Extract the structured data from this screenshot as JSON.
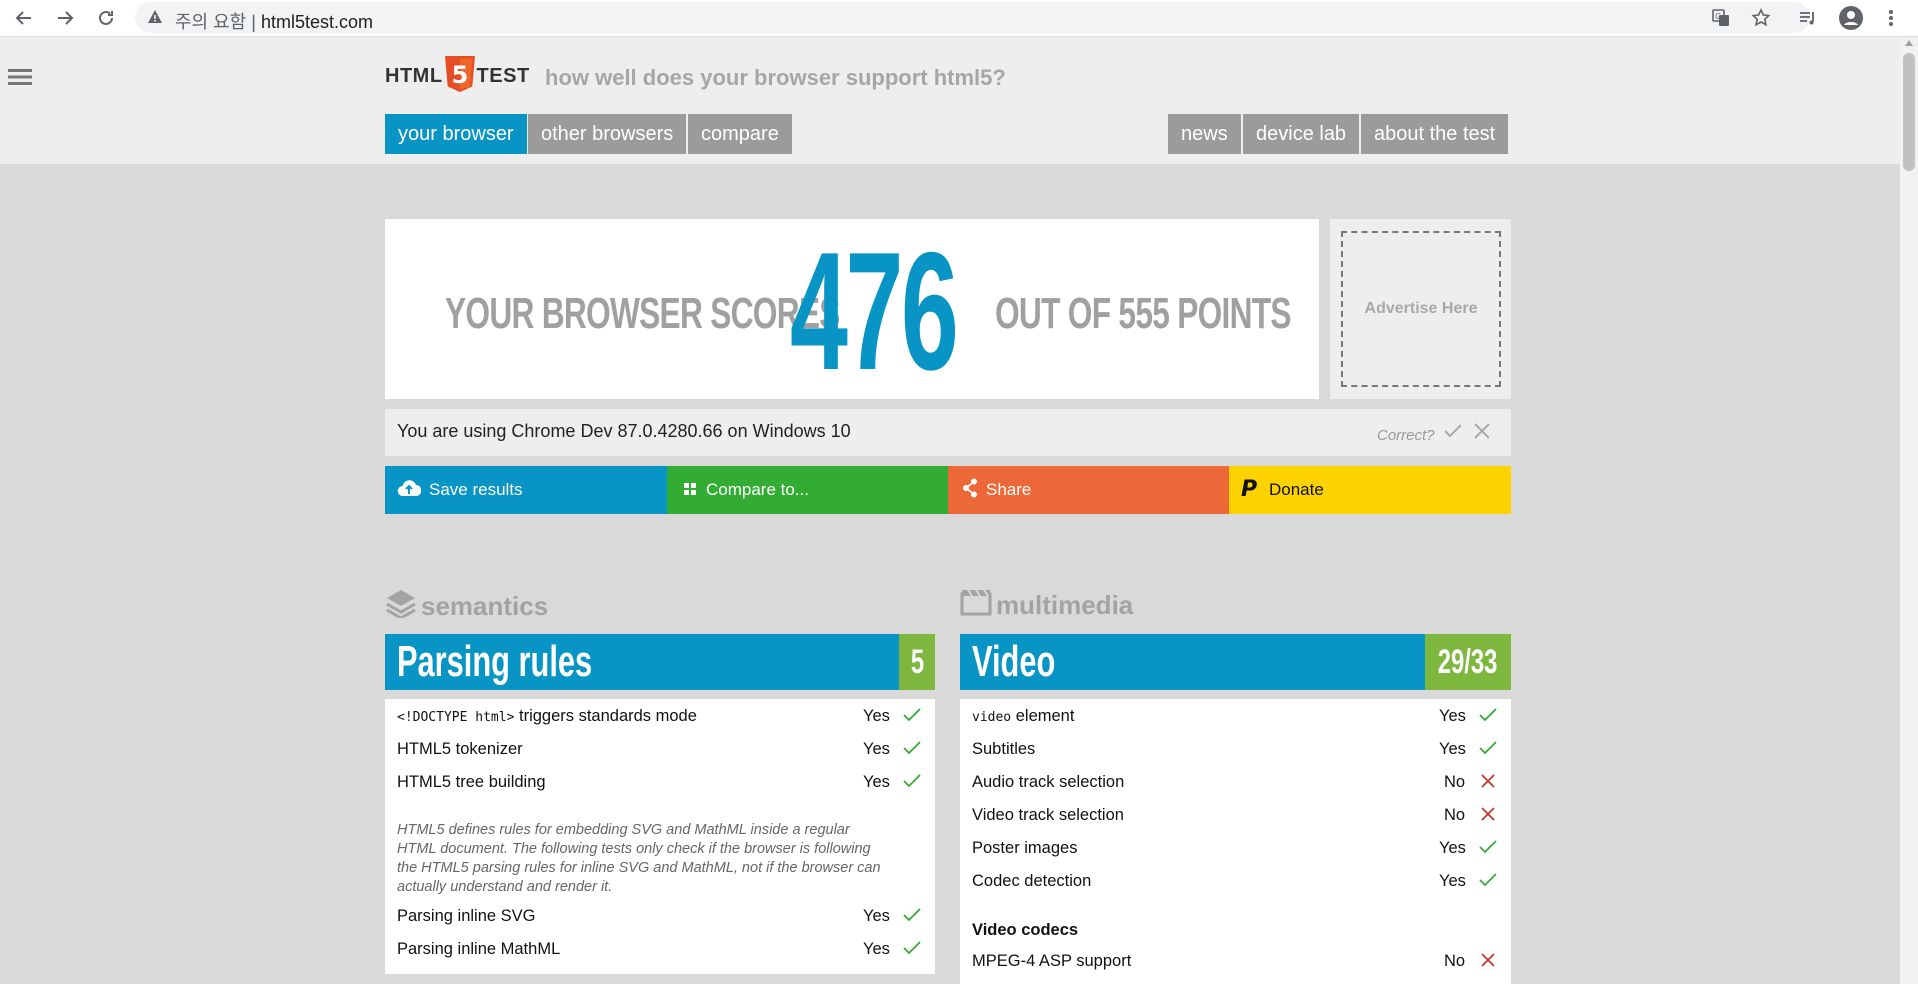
{
  "browser": {
    "security_label": "주의 요함",
    "separator": "|",
    "url": "html5test.com"
  },
  "header": {
    "logo_left": "HTML",
    "logo_digit": "5",
    "logo_right": "TEST",
    "tagline": "how well does your browser support html5?",
    "nav_left": [
      {
        "label": "your browser"
      },
      {
        "label": "other browsers"
      },
      {
        "label": "compare"
      }
    ],
    "nav_right": [
      {
        "label": "news"
      },
      {
        "label": "device lab"
      },
      {
        "label": "about the test"
      }
    ]
  },
  "score": {
    "prefix": "YOUR BROWSER SCORES",
    "value": "476",
    "suffix": "OUT OF 555 POINTS",
    "ad_label": "Advertise Here"
  },
  "ua": {
    "text": "You are using Chrome Dev 87.0.4280.66 on Windows 10",
    "correct_label": "Correct?"
  },
  "actions": {
    "save": "Save results",
    "compare": "Compare to...",
    "share": "Share",
    "donate": "Donate"
  },
  "colors": {
    "blue": "#0894c4",
    "green": "#33ac33",
    "orange": "#ec6838",
    "yellow": "#fcd200",
    "score_green": "#7db73e",
    "yes_check": "#33ac33",
    "no_cross": "#c0392b"
  },
  "semantics": {
    "section_label": "semantics",
    "category": "Parsing rules",
    "score": "5",
    "rows": [
      {
        "code": "<!DOCTYPE html>",
        "name": " triggers standards mode",
        "result": "Yes"
      },
      {
        "name": "HTML5 tokenizer",
        "result": "Yes"
      },
      {
        "name": "HTML5 tree building",
        "result": "Yes"
      }
    ],
    "note": "HTML5 defines rules for embedding SVG and MathML inside a regular HTML document. The following tests only check if the browser is following the HTML5 parsing rules for inline SVG and MathML, not if the browser can actually understand and render it.",
    "rows2": [
      {
        "name": "Parsing inline SVG",
        "result": "Yes"
      },
      {
        "name": "Parsing inline MathML",
        "result": "Yes"
      }
    ]
  },
  "multimedia": {
    "section_label": "multimedia",
    "category": "Video",
    "score": "29/33",
    "rows": [
      {
        "code": "video",
        "name": " element",
        "result": "Yes"
      },
      {
        "name": "Subtitles",
        "result": "Yes"
      },
      {
        "name": "Audio track selection",
        "result": "No"
      },
      {
        "name": "Video track selection",
        "result": "No"
      },
      {
        "name": "Poster images",
        "result": "Yes"
      },
      {
        "name": "Codec detection",
        "result": "Yes"
      }
    ],
    "subheading": "Video codecs",
    "rows2": [
      {
        "name": "MPEG-4 ASP support",
        "result": "No"
      }
    ]
  }
}
